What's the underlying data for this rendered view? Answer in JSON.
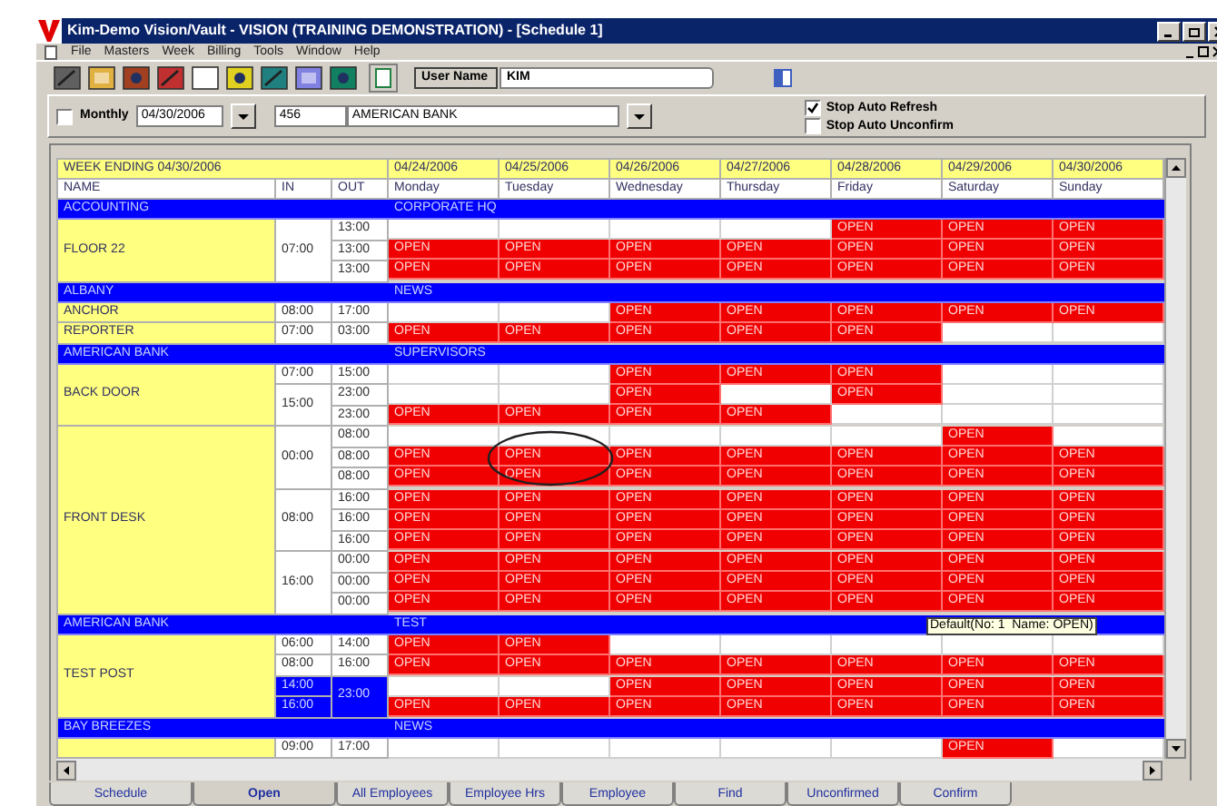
{
  "window": {
    "title": "Kim-Demo Vision/Vault - VISION (TRAINING DEMONSTRATION) - [Schedule 1]"
  },
  "menu": [
    "File",
    "Masters",
    "Week",
    "Billing",
    "Tools",
    "Window",
    "Help"
  ],
  "toolbar": {
    "user_label": "User Name",
    "user_value": "KIM"
  },
  "filter": {
    "monthly": {
      "label": "Monthly",
      "checked": false
    },
    "date": "04/30/2006",
    "client_code": "456",
    "client_name": "AMERICAN BANK",
    "options": [
      {
        "label": "Stop Auto Refresh",
        "checked": true
      },
      {
        "label": "Stop Auto Unconfirm",
        "checked": false
      }
    ]
  },
  "grid": {
    "week_label": "WEEK ENDING 04/30/2006",
    "columns": {
      "name": "NAME",
      "in": "IN",
      "out": "OUT"
    },
    "days": [
      {
        "date": "04/24/2006",
        "day": "Monday"
      },
      {
        "date": "04/25/2006",
        "day": "Tuesday"
      },
      {
        "date": "04/26/2006",
        "day": "Wednesday"
      },
      {
        "date": "04/27/2006",
        "day": "Thursday"
      },
      {
        "date": "04/28/2006",
        "day": "Friday"
      },
      {
        "date": "04/29/2006",
        "day": "Saturday"
      },
      {
        "date": "04/30/2006",
        "day": "Sunday"
      }
    ],
    "groups": [
      {
        "client": "ACCOUNTING",
        "site": "CORPORATE HQ",
        "posts": [
          {
            "name": "FLOOR 22",
            "blocks": [
              {
                "ins": [
                  "07:00"
                ],
                "outs": [
                  "13:00",
                  "13:00",
                  "13:00"
                ],
                "selected": false,
                "rows": [
                  [
                    null,
                    null,
                    null,
                    null,
                    "OPEN",
                    "OPEN",
                    "OPEN"
                  ],
                  [
                    "OPEN",
                    "OPEN",
                    "OPEN",
                    "OPEN",
                    "OPEN",
                    "OPEN",
                    "OPEN"
                  ],
                  [
                    "OPEN",
                    "OPEN",
                    "OPEN",
                    "OPEN",
                    "OPEN",
                    "OPEN",
                    "OPEN"
                  ]
                ]
              }
            ]
          }
        ]
      },
      {
        "client": "ALBANY",
        "site": "NEWS",
        "posts": [
          {
            "name": "ANCHOR",
            "blocks": [
              {
                "ins": [
                  "08:00"
                ],
                "outs": [
                  "17:00"
                ],
                "selected": false,
                "rows": [
                  [
                    null,
                    null,
                    "OPEN",
                    "OPEN",
                    "OPEN",
                    "OPEN",
                    "OPEN"
                  ]
                ]
              }
            ]
          },
          {
            "name": "REPORTER",
            "blocks": [
              {
                "ins": [
                  "07:00"
                ],
                "outs": [
                  "03:00"
                ],
                "selected": false,
                "rows": [
                  [
                    "OPEN",
                    "OPEN",
                    "OPEN",
                    "OPEN",
                    "OPEN",
                    null,
                    null
                  ]
                ]
              }
            ]
          }
        ]
      },
      {
        "client": "AMERICAN BANK",
        "site": "SUPERVISORS",
        "posts": [
          {
            "name": "BACK DOOR",
            "blocks": [
              {
                "ins": [
                  "07:00"
                ],
                "outs": [
                  "15:00"
                ],
                "selected": false,
                "rows": [
                  [
                    null,
                    null,
                    "OPEN",
                    "OPEN",
                    "OPEN",
                    null,
                    null
                  ]
                ]
              },
              {
                "ins": [
                  "15:00"
                ],
                "outs": [
                  "23:00",
                  "23:00"
                ],
                "selected": false,
                "rows": [
                  [
                    null,
                    null,
                    "OPEN",
                    null,
                    "OPEN",
                    null,
                    null
                  ],
                  [
                    "OPEN",
                    "OPEN",
                    "OPEN",
                    "OPEN",
                    null,
                    null,
                    null
                  ]
                ]
              }
            ]
          },
          {
            "name": "FRONT DESK",
            "blocks": [
              {
                "ins": [
                  "00:00"
                ],
                "outs": [
                  "08:00",
                  "08:00",
                  "08:00"
                ],
                "selected": false,
                "rows": [
                  [
                    null,
                    null,
                    null,
                    null,
                    null,
                    "OPEN",
                    null
                  ],
                  [
                    "OPEN",
                    "OPEN",
                    "OPEN",
                    "OPEN",
                    "OPEN",
                    "OPEN",
                    "OPEN"
                  ],
                  [
                    "OPEN",
                    "OPEN",
                    "OPEN",
                    "OPEN",
                    "OPEN",
                    "OPEN",
                    "OPEN"
                  ]
                ]
              },
              {
                "ins": [
                  "08:00"
                ],
                "outs": [
                  "16:00",
                  "16:00",
                  "16:00"
                ],
                "selected": false,
                "rows": [
                  [
                    "OPEN",
                    "OPEN",
                    "OPEN",
                    "OPEN",
                    "OPEN",
                    "OPEN",
                    "OPEN"
                  ],
                  [
                    "OPEN",
                    "OPEN",
                    "OPEN",
                    "OPEN",
                    "OPEN",
                    "OPEN",
                    "OPEN"
                  ],
                  [
                    "OPEN",
                    "OPEN",
                    "OPEN",
                    "OPEN",
                    "OPEN",
                    "OPEN",
                    "OPEN"
                  ]
                ]
              },
              {
                "ins": [
                  "16:00"
                ],
                "outs": [
                  "00:00",
                  "00:00",
                  "00:00"
                ],
                "selected": false,
                "rows": [
                  [
                    "OPEN",
                    "OPEN",
                    "OPEN",
                    "OPEN",
                    "OPEN",
                    "OPEN",
                    "OPEN"
                  ],
                  [
                    "OPEN",
                    "OPEN",
                    "OPEN",
                    "OPEN",
                    "OPEN",
                    "OPEN",
                    "OPEN"
                  ],
                  [
                    "OPEN",
                    "OPEN",
                    "OPEN",
                    "OPEN",
                    "OPEN",
                    "OPEN",
                    "OPEN"
                  ]
                ]
              }
            ]
          }
        ]
      },
      {
        "client": "AMERICAN BANK",
        "site": "TEST",
        "tooltip": "Default(No: 1  Name: OPEN)",
        "posts": [
          {
            "name": "TEST POST",
            "blocks": [
              {
                "ins": [
                  "06:00"
                ],
                "outs": [
                  "14:00"
                ],
                "selected": false,
                "rows": [
                  [
                    "OPEN",
                    "OPEN",
                    null,
                    null,
                    null,
                    null,
                    null
                  ]
                ]
              },
              {
                "ins": [
                  "08:00"
                ],
                "outs": [
                  "16:00"
                ],
                "selected": false,
                "rows": [
                  [
                    "OPEN",
                    "OPEN",
                    "OPEN",
                    "OPEN",
                    "OPEN",
                    "OPEN",
                    "OPEN"
                  ]
                ]
              },
              {
                "ins": [
                  "14:00",
                  "16:00"
                ],
                "outs": [
                  "23:00"
                ],
                "selected": true,
                "rows": [
                  [
                    null,
                    null,
                    "OPEN",
                    "OPEN",
                    "OPEN",
                    "OPEN",
                    "OPEN"
                  ],
                  [
                    "OPEN",
                    "OPEN",
                    "OPEN",
                    "OPEN",
                    "OPEN",
                    "OPEN",
                    "OPEN"
                  ]
                ]
              }
            ]
          }
        ]
      },
      {
        "client": "BAY BREEZES",
        "site": "NEWS",
        "posts": [
          {
            "blocks": [
              {
                "ins": [
                  "09:00"
                ],
                "outs": [
                  "17:00"
                ],
                "selected": false,
                "rows": [
                  [
                    null,
                    null,
                    null,
                    null,
                    null,
                    "OPEN",
                    null
                  ]
                ]
              }
            ]
          }
        ]
      }
    ]
  },
  "tabs": [
    {
      "label": "Schedule",
      "selected": false
    },
    {
      "label": "Open",
      "selected": true
    },
    {
      "label": "All Employees",
      "selected": false
    },
    {
      "label": "Employee Hrs",
      "selected": false
    },
    {
      "label": "Employee",
      "selected": false
    },
    {
      "label": "Find",
      "selected": false
    },
    {
      "label": "Unconfirmed",
      "selected": false
    },
    {
      "label": "Confirm",
      "selected": false
    }
  ]
}
